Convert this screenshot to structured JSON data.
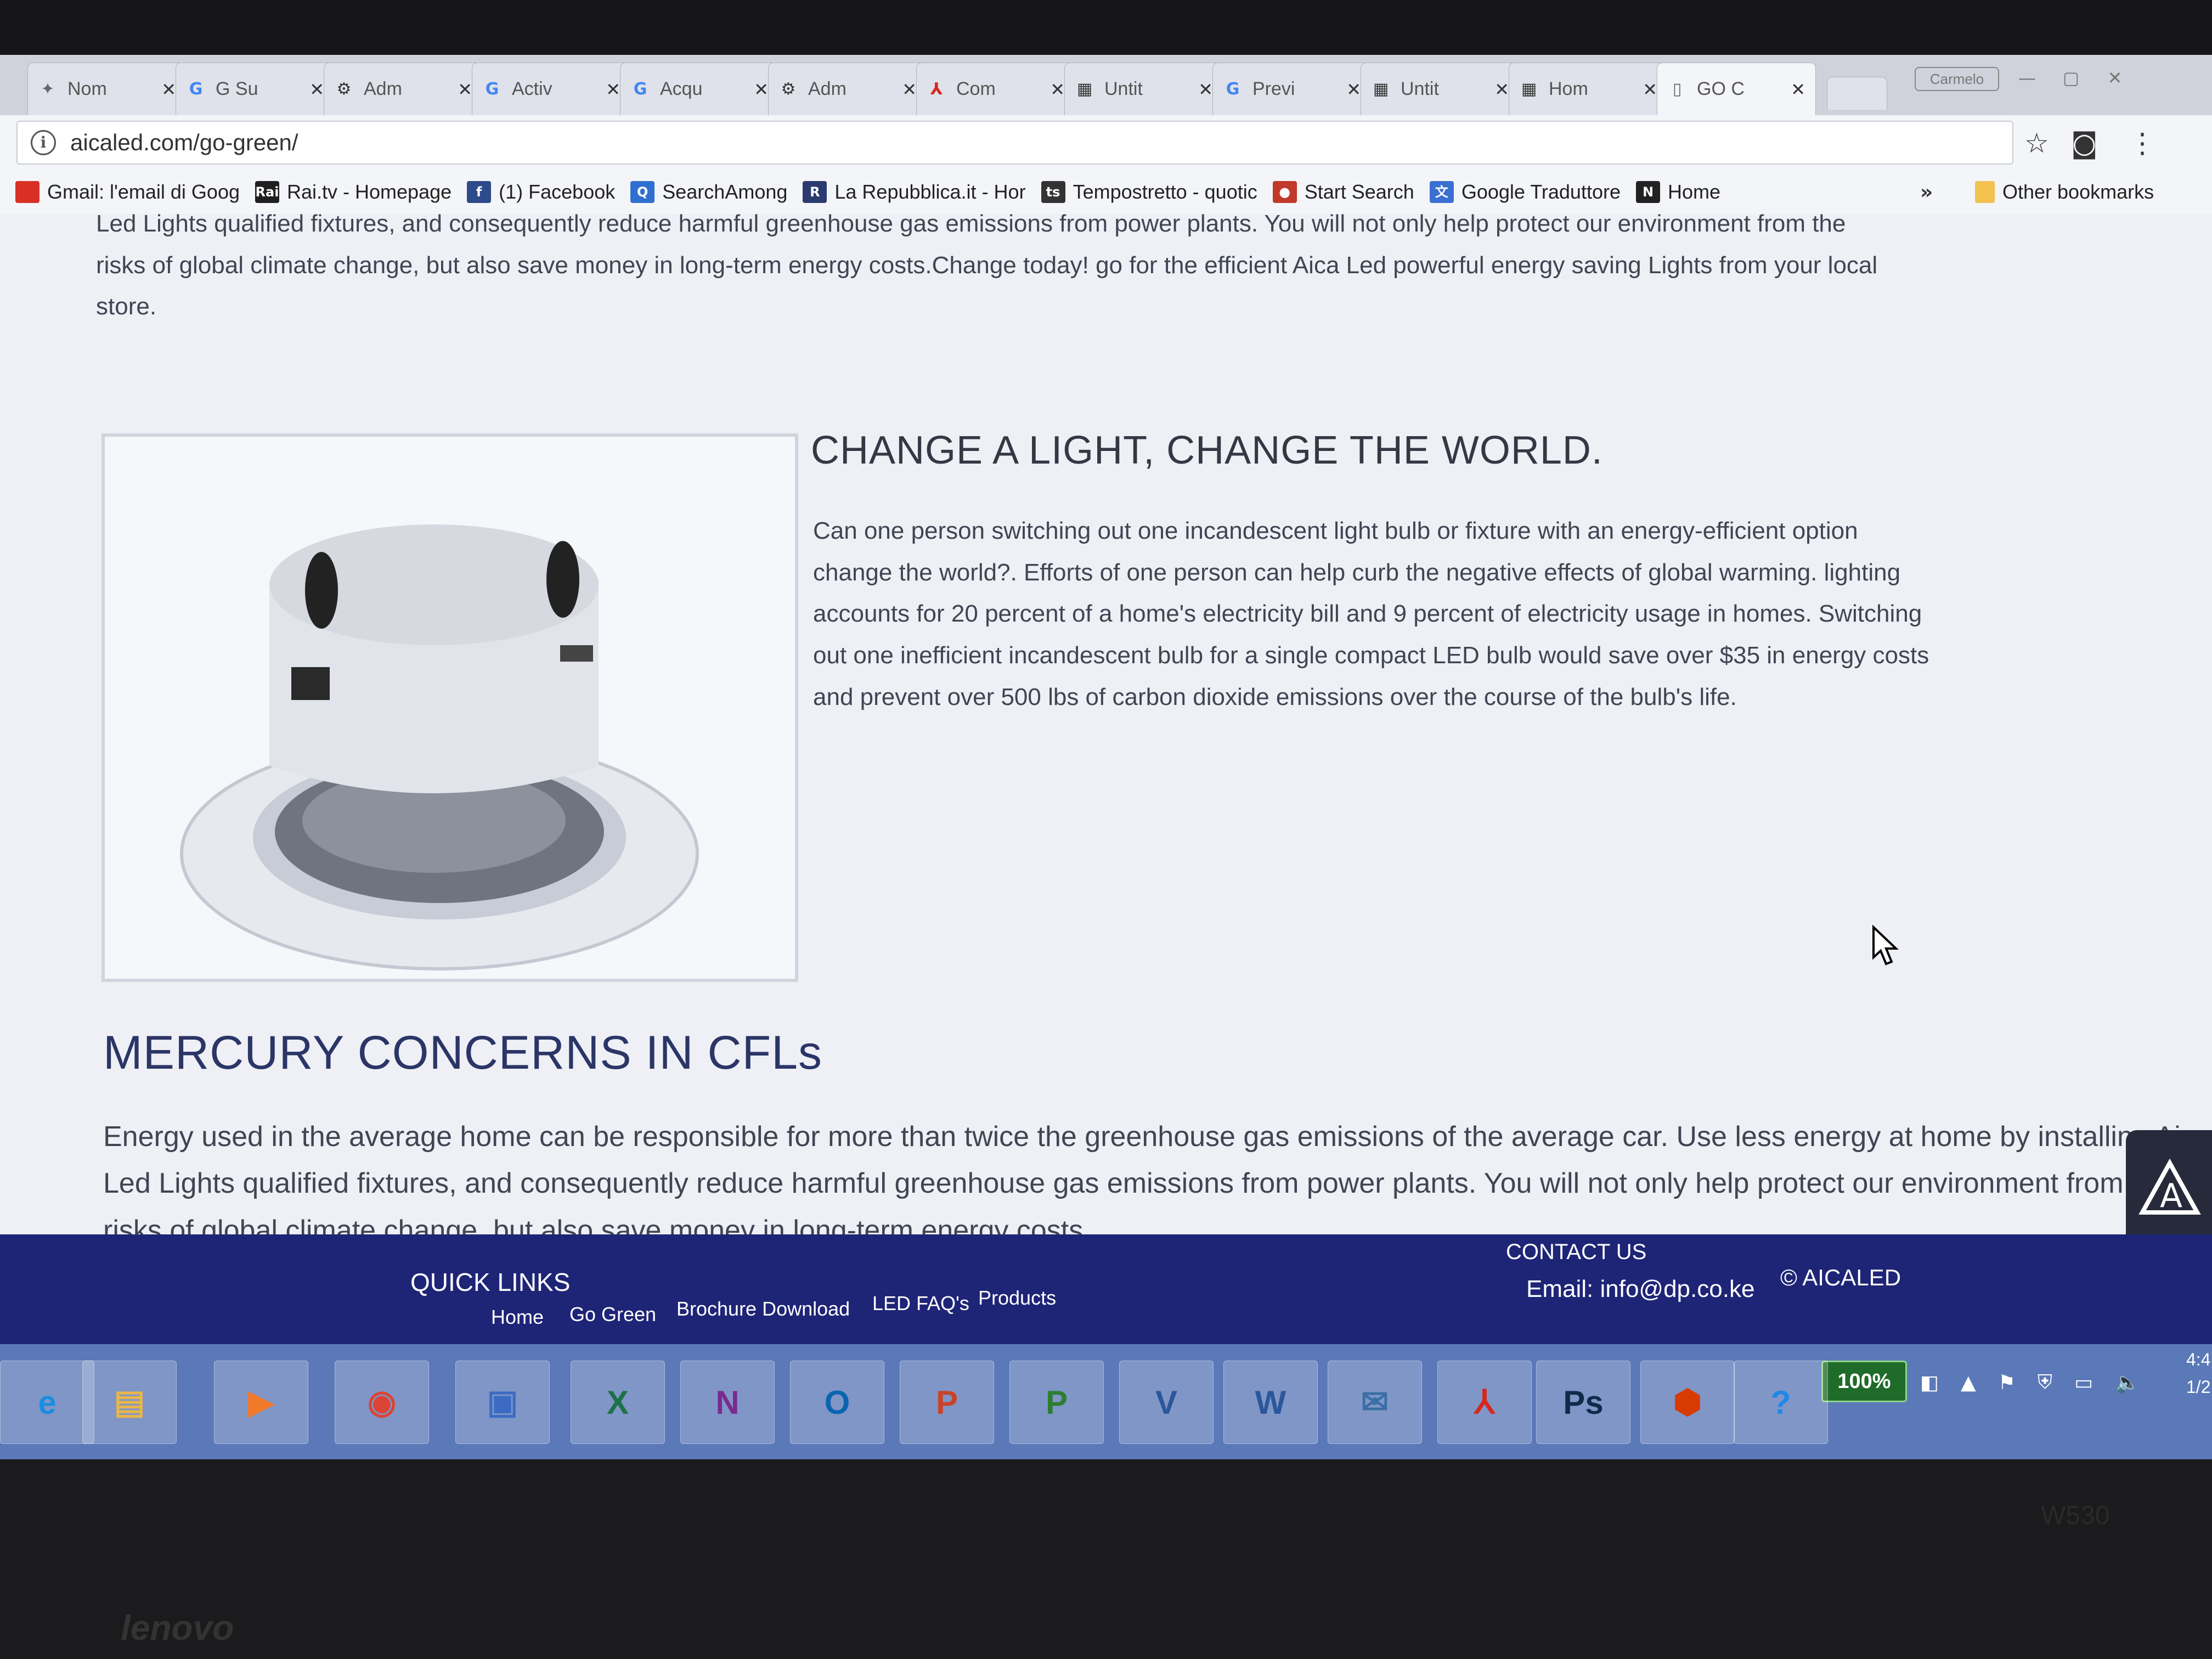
{
  "browser": {
    "tabs": [
      {
        "title": "Nom",
        "icon": "puzzle-icon"
      },
      {
        "title": "G Su",
        "icon": "google-icon"
      },
      {
        "title": "Adm",
        "icon": "gear-icon"
      },
      {
        "title": "Activ",
        "icon": "google-icon"
      },
      {
        "title": "Acqu",
        "icon": "google-icon"
      },
      {
        "title": "Adm",
        "icon": "gear-icon"
      },
      {
        "title": "Com",
        "icon": "acrobat-icon"
      },
      {
        "title": "Untit",
        "icon": "layout-icon"
      },
      {
        "title": "Previ",
        "icon": "google-icon"
      },
      {
        "title": "Untit",
        "icon": "layout-icon"
      },
      {
        "title": "Hom",
        "icon": "layout-icon"
      },
      {
        "title": "GO C",
        "icon": "page-icon"
      }
    ],
    "close_glyph": "✕",
    "profile_label": "Carmelo",
    "url": "aicaled.com/go-green/",
    "bookmarks": [
      {
        "label": "Gmail: l'email di Goog",
        "icon": "gmail-icon",
        "color": "#d93025",
        "glyph": ""
      },
      {
        "label": "Rai.tv - Homepage",
        "icon": "rai-icon",
        "color": "#1f1f1f",
        "glyph": "Rai"
      },
      {
        "label": "(1) Facebook",
        "icon": "facebook-icon",
        "color": "#2d4a8a",
        "glyph": "f"
      },
      {
        "label": "SearchAmong",
        "icon": "search-icon",
        "color": "#2f6fd0",
        "glyph": "Q"
      },
      {
        "label": "La Repubblica.it - Hor",
        "icon": "repubblica-icon",
        "color": "#2b3b70",
        "glyph": "R"
      },
      {
        "label": "Tempostretto - quotic",
        "icon": "tempostretto-icon",
        "color": "#333333",
        "glyph": "ts"
      },
      {
        "label": "Start Search",
        "icon": "chat-bubble-icon",
        "color": "#c0392b",
        "glyph": "●"
      },
      {
        "label": "Google Traduttore",
        "icon": "translate-icon",
        "color": "#3b6fd1",
        "glyph": "文"
      },
      {
        "label": "Home",
        "icon": "n-logo-icon",
        "color": "#222222",
        "glyph": "N"
      }
    ],
    "bookmarks_more": "»",
    "other_bookmarks": "Other bookmarks"
  },
  "page": {
    "intro_lines": [
      "Led Lights qualified fixtures, and consequently reduce harmful greenhouse gas emissions from power plants. You will not only help protect our environment from the",
      "risks of global climate change, but also save money in long-term energy costs.Change today! go for the efficient Aica Led powerful energy saving Lights from your local",
      "store."
    ],
    "section1": {
      "title": "CHANGE A LIGHT, CHANGE THE WORLD.",
      "lines": [
        "Can one person switching out one incandescent light bulb or fixture with an energy-efficient option",
        "change the world?. Efforts of one person can help curb the negative effects of global warming. lighting",
        "accounts for 20 percent of a home's electricity bill and 9 percent of electricity usage in homes. Switching",
        "out one inefficient incandescent bulb for a single compact LED bulb would save over $35 in energy costs",
        "and prevent over 500 lbs of carbon dioxide emissions over the course of the bulb's life."
      ]
    },
    "section2": {
      "title": "MERCURY CONCERNS IN CFLs",
      "lines": [
        "Energy used in the average home can be responsible for more than twice the greenhouse gas emissions of the average car. Use less energy at home by installing Aica",
        "Led Lights qualified fixtures, and consequently reduce harmful greenhouse gas emissions from power plants. You will not only help protect our environment from the",
        "risks of global climate change, but also save money in long-term energy costs.."
      ]
    }
  },
  "footer": {
    "quick_links_title": "QUICK LINKS",
    "links": [
      "Home",
      "Go Green",
      "Brochure Download",
      "LED FAQ's",
      "Products"
    ],
    "contact_title": "CONTACT US",
    "email": "Email: info@dp.co.ke",
    "copyright": "© AICALED"
  },
  "taskbar": {
    "apps": [
      {
        "name": "internet-explorer-icon",
        "glyph": "e",
        "color": "#1a8de0"
      },
      {
        "name": "file-explorer-icon",
        "glyph": "▤",
        "color": "#e8b64a"
      },
      {
        "name": "media-player-icon",
        "glyph": "▶",
        "color": "#f07a2a"
      },
      {
        "name": "chrome-icon",
        "glyph": "◉",
        "color": "#db4437"
      },
      {
        "name": "calendar-icon",
        "glyph": "▣",
        "color": "#3d6bc4"
      },
      {
        "name": "excel-icon",
        "glyph": "X",
        "color": "#1e7145"
      },
      {
        "name": "onenote-icon",
        "glyph": "N",
        "color": "#7b2a8f"
      },
      {
        "name": "outlook-icon",
        "glyph": "O",
        "color": "#0a64b0"
      },
      {
        "name": "powerpoint-icon",
        "glyph": "P",
        "color": "#c9432a"
      },
      {
        "name": "project-icon",
        "glyph": "P",
        "color": "#2e7d32"
      },
      {
        "name": "visio-icon",
        "glyph": "V",
        "color": "#2b579a"
      },
      {
        "name": "word-icon",
        "glyph": "W",
        "color": "#2b579a"
      },
      {
        "name": "thunderbird-icon",
        "glyph": "✉",
        "color": "#3a6ea5"
      },
      {
        "name": "acrobat-icon",
        "glyph": "⅄",
        "color": "#d9261c"
      },
      {
        "name": "photoshop-icon",
        "glyph": "Ps",
        "color": "#0f2b4a"
      },
      {
        "name": "office-icon",
        "glyph": "⬢",
        "color": "#d83b01"
      },
      {
        "name": "help-icon",
        "glyph": "?",
        "color": "#1e88e5"
      }
    ],
    "battery": "100%",
    "clock_top": "4:4",
    "clock_bottom": "1/2"
  },
  "hardware": {
    "brand": "lenovo",
    "model": "W530"
  }
}
